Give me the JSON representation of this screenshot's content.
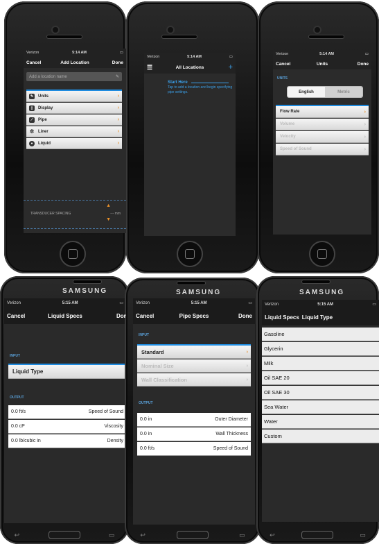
{
  "status": {
    "carrier": "Verizon",
    "time_ios": "5:14 AM",
    "time_samsung": "5:15 AM"
  },
  "samsung_brand": "SAMSUNG",
  "ios1": {
    "cancel": "Cancel",
    "title": "Add Location",
    "done": "Done",
    "placeholder": "Add a location name",
    "items": [
      {
        "label": "Units",
        "icon": "pencil-icon"
      },
      {
        "label": "Display",
        "icon": "phone-icon"
      },
      {
        "label": "Pipe",
        "icon": "pipe-icon"
      },
      {
        "label": "Liner",
        "icon": "gear-icon"
      },
      {
        "label": "Liquid",
        "icon": "drop-icon"
      }
    ],
    "transducer_label": "TRANSDUCER SPACING",
    "transducer_value": "--- mm"
  },
  "ios2": {
    "title": "All Locations",
    "hint_title": "Start Here",
    "hint_body": "Tap to add a location and begin specifying pipe settings."
  },
  "ios3": {
    "cancel": "Cancel",
    "title": "Units",
    "done": "Done",
    "section": "UNITS",
    "seg": [
      "English",
      "Metric"
    ],
    "items": [
      "Flow Rate",
      "Volume",
      "Velocity",
      "Speed of Sound"
    ]
  },
  "s1": {
    "cancel": "Cancel",
    "title": "Liquid Specs",
    "done": "Done",
    "input_label": "INPUT",
    "row": "Liquid Type",
    "output_label": "OUTPUT",
    "outputs": [
      {
        "value": "0.0 ft/s",
        "name": "Speed of Sound"
      },
      {
        "value": "0.0 cP",
        "name": "Viscosity"
      },
      {
        "value": "0.0 lb/cubic in",
        "name": "Density"
      }
    ]
  },
  "s2": {
    "cancel": "Cancel",
    "title": "Pipe Specs",
    "done": "Done",
    "input_label": "INPUT",
    "inputs": [
      "Standard",
      "Nominal Size",
      "Wall Classification"
    ],
    "output_label": "OUTPUT",
    "outputs": [
      {
        "value": "0.0 in",
        "name": "Outer Diameter"
      },
      {
        "value": "0.0 in",
        "name": "Wall Thickness"
      },
      {
        "value": "0.0 ft/s",
        "name": "Speed of Sound"
      }
    ]
  },
  "s3": {
    "title_left": "Liquid Specs",
    "title": "Liquid Type",
    "liquids": [
      "Gasoline",
      "Glycerin",
      "Milk",
      "Oil SAE 20",
      "Oil SAE 30",
      "Sea Water",
      "Water",
      "Custom"
    ]
  },
  "nav_icons": {
    "back": "back-icon",
    "home": "home-icon",
    "recent": "recent-apps-icon"
  }
}
